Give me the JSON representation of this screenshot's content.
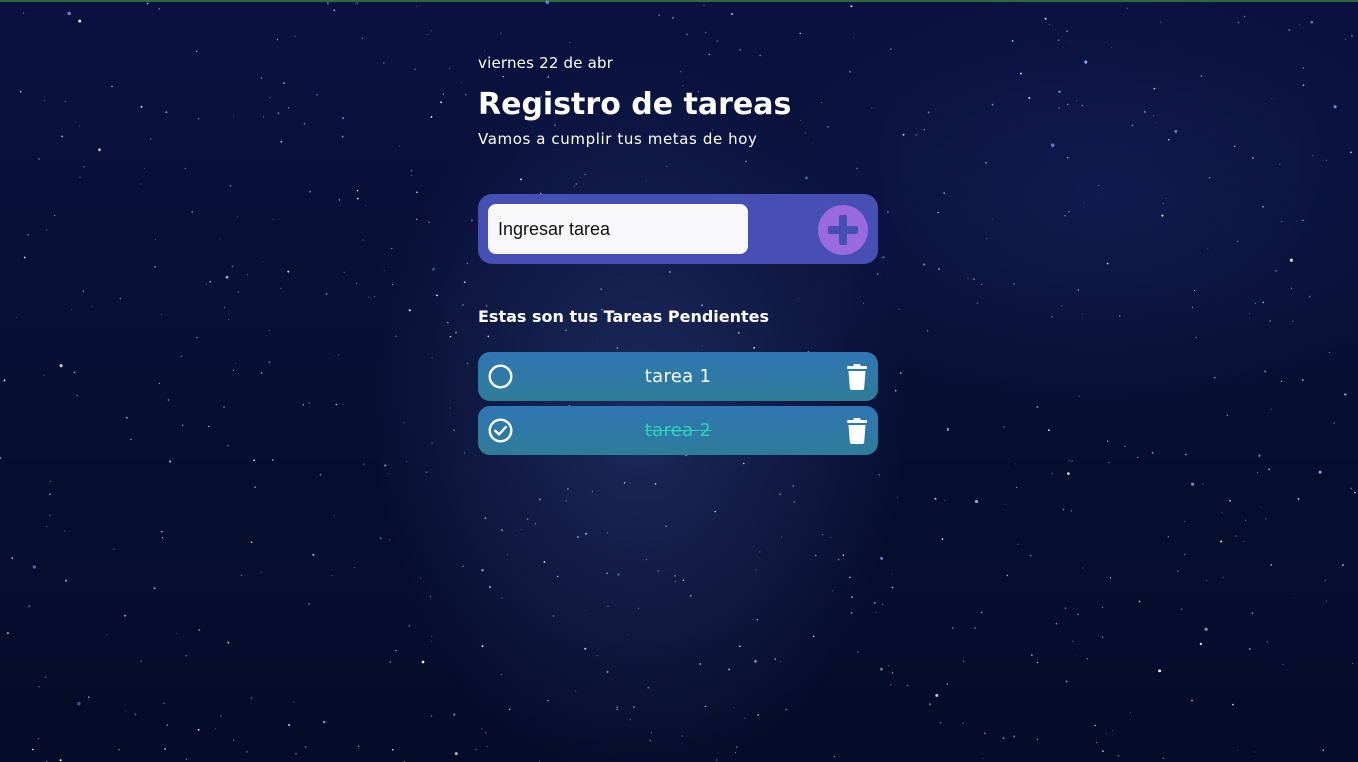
{
  "header": {
    "date": "viernes 22 de abr",
    "title": "Registro de tareas",
    "subtitle": "Vamos a cumplir tus metas de hoy"
  },
  "task_input": {
    "placeholder": "Ingresar tarea",
    "value": ""
  },
  "add_button": {
    "icon": "plus-circle-icon",
    "color": "#9b6ae0"
  },
  "section_title": "Estas son tus Tareas Pendientes",
  "tasks": [
    {
      "label": "tarea 1",
      "completed": false,
      "check_icon": "circle-icon",
      "delete_icon": "trash-icon"
    },
    {
      "label": "tarea 2",
      "completed": true,
      "check_icon": "check-circle-icon",
      "delete_icon": "trash-icon"
    }
  ],
  "colors": {
    "input_bar": "#4650b4",
    "task_bg": "#2f76b4",
    "completed_text": "#2fd2c0",
    "text": "#ffffff"
  }
}
